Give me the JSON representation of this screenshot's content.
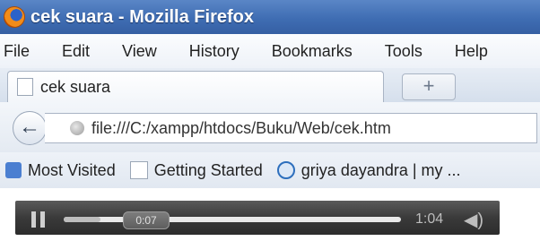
{
  "window": {
    "title": "cek suara - Mozilla Firefox"
  },
  "menu": {
    "items": [
      {
        "label": "File"
      },
      {
        "label": "Edit"
      },
      {
        "label": "View"
      },
      {
        "label": "History"
      },
      {
        "label": "Bookmarks"
      },
      {
        "label": "Tools"
      },
      {
        "label": "Help"
      }
    ]
  },
  "tabs": [
    {
      "label": "cek suara",
      "active": true
    }
  ],
  "new_tab": {
    "label": "+"
  },
  "navigation": {
    "back_glyph": "←",
    "url": "file:///C:/xampp/htdocs/Buku/Web/cek.htm"
  },
  "bookmarks": {
    "items": [
      {
        "label": "Most Visited",
        "icon": "most-visited-icon"
      },
      {
        "label": "Getting Started",
        "icon": "page-icon"
      },
      {
        "label": "griya dayandra | my ...",
        "icon": "wordpress-icon"
      }
    ]
  },
  "audio_player": {
    "current_time": "0:07",
    "duration": "1:04",
    "progress_fraction": 0.11,
    "state": "playing",
    "volume_glyph": "◀)"
  }
}
